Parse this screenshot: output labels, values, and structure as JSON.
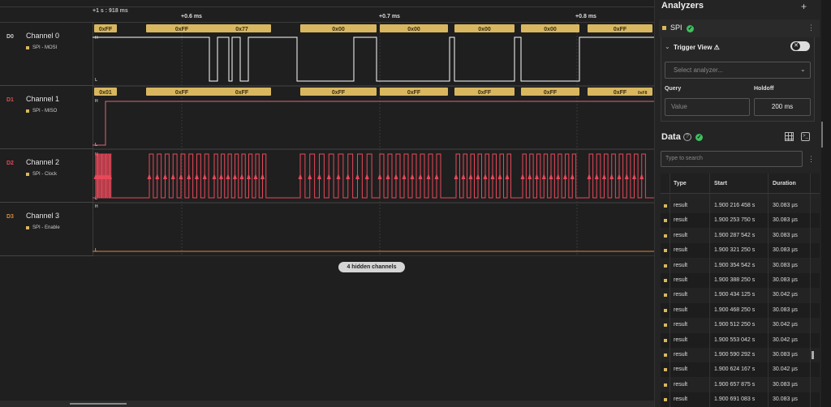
{
  "colors": {
    "mosi": "#ffffff",
    "miso": "#d46a7a",
    "clock": "#e8485a",
    "enable": "#d88a3a",
    "badge": "#d8b760",
    "ok": "#3fbf5f"
  },
  "ruler": {
    "origin": "+1 s : 918 ms",
    "ticks": [
      "+0.6 ms",
      "+0.7 ms",
      "+0.8 ms"
    ]
  },
  "channels": [
    {
      "id": "D0",
      "name": "Channel 0",
      "sub": "SPI - MOSI",
      "id_color": "#cccccc"
    },
    {
      "id": "D1",
      "name": "Channel 1",
      "sub": "SPI - MISO",
      "id_color": "#d8534f"
    },
    {
      "id": "D2",
      "name": "Channel 2",
      "sub": "SPI - Clock",
      "id_color": "#e8485a"
    },
    {
      "id": "D3",
      "name": "Channel 3",
      "sub": "SPI - Enable",
      "id_color": "#d88a3a"
    }
  ],
  "levels": {
    "high": "H",
    "low": "L"
  },
  "mosi_bytes": [
    "0xFF",
    "0xFF",
    "0x77",
    "0x00",
    "0x00",
    "0x00",
    "0x00",
    "0xFF"
  ],
  "miso_bytes": [
    "0x01",
    "0xFF",
    "0xFF",
    "0xFF",
    "0xFF",
    "0xFF",
    "0xFF",
    "0xFF"
  ],
  "miso_tail": "0xF8",
  "hidden_channels": "4 hidden channels",
  "analyzers": {
    "title": "Analyzers",
    "plus_icon": "plus-icon",
    "item": "SPI"
  },
  "trigger": {
    "title": "Trigger View",
    "warning_icon": "warning-icon",
    "select_placeholder": "Select analyzer...",
    "query_label": "Query",
    "query_placeholder": "Value",
    "holdoff_label": "Holdoff",
    "holdoff_value": "200 ms"
  },
  "data_panel": {
    "title": "Data",
    "search_placeholder": "Type to search",
    "columns": [
      "Type",
      "Start",
      "Duration"
    ],
    "rows": [
      {
        "type": "result",
        "start": "1.900 216 458 s",
        "duration": "30.083 µs"
      },
      {
        "type": "result",
        "start": "1.900 253 750 s",
        "duration": "30.083 µs"
      },
      {
        "type": "result",
        "start": "1.900 287 542 s",
        "duration": "30.083 µs"
      },
      {
        "type": "result",
        "start": "1.900 321 250 s",
        "duration": "30.083 µs"
      },
      {
        "type": "result",
        "start": "1.900 354 542 s",
        "duration": "30.083 µs"
      },
      {
        "type": "result",
        "start": "1.900 388 250 s",
        "duration": "30.083 µs"
      },
      {
        "type": "result",
        "start": "1.900 434 125 s",
        "duration": "30.042 µs"
      },
      {
        "type": "result",
        "start": "1.900 468 250 s",
        "duration": "30.083 µs"
      },
      {
        "type": "result",
        "start": "1.900 512 250 s",
        "duration": "30.042 µs"
      },
      {
        "type": "result",
        "start": "1.900 553 042 s",
        "duration": "30.042 µs"
      },
      {
        "type": "result",
        "start": "1.900 590 292 s",
        "duration": "30.083 µs"
      },
      {
        "type": "result",
        "start": "1.900 624 167 s",
        "duration": "30.042 µs"
      },
      {
        "type": "result",
        "start": "1.900 657 875 s",
        "duration": "30.083 µs"
      },
      {
        "type": "result",
        "start": "1.900 691 083 s",
        "duration": "30.083 µs"
      }
    ]
  }
}
